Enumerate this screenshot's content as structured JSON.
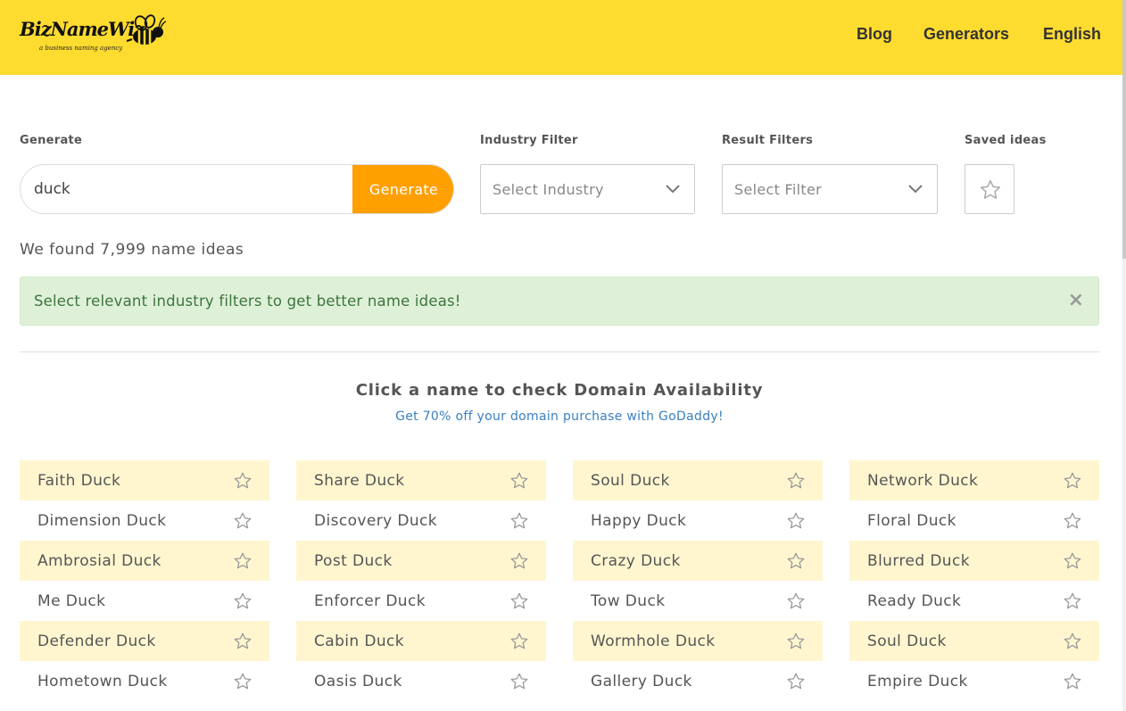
{
  "header": {
    "logo_text": "BizNameWiz",
    "logo_tagline": "a business naming agency",
    "nav": [
      "Blog",
      "Generators",
      "English"
    ],
    "brand_color": "#fedb2f"
  },
  "form": {
    "generate_label": "Generate",
    "search_value": "duck",
    "generate_button": "Generate",
    "industry_label": "Industry Filter",
    "industry_placeholder": "Select Industry",
    "result_label": "Result Filters",
    "result_placeholder": "Select Filter",
    "saved_label": "Saved ideas",
    "accent_color": "#ff9f00"
  },
  "results": {
    "found_text": "We found 7,999 name ideas",
    "alert_text": "Select relevant industry filters to get better name ideas!",
    "alert_close": "×",
    "click_title": "Click a name to check Domain Availability",
    "promo_text": "Get 70% off your domain purchase with GoDaddy!"
  },
  "names": {
    "columns": [
      [
        "Faith Duck",
        "Dimension Duck",
        "Ambrosial Duck",
        "Me Duck",
        "Defender Duck",
        "Hometown Duck"
      ],
      [
        "Share Duck",
        "Discovery Duck",
        "Post Duck",
        "Enforcer Duck",
        "Cabin Duck",
        "Oasis Duck"
      ],
      [
        "Soul Duck",
        "Happy Duck",
        "Crazy Duck",
        "Tow Duck",
        "Wormhole Duck",
        "Gallery Duck"
      ],
      [
        "Network Duck",
        "Floral Duck",
        "Blurred Duck",
        "Ready Duck",
        "Soul Duck",
        "Empire Duck"
      ]
    ],
    "highlight_color": "#fff6d0",
    "icon": "star-outline-icon"
  }
}
